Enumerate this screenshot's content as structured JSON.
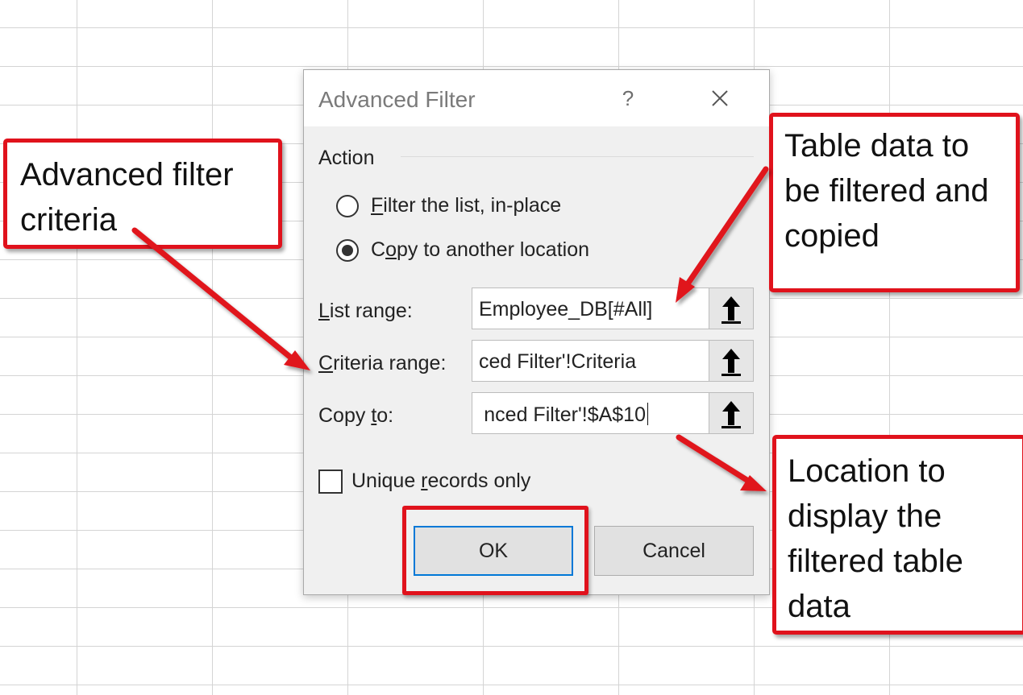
{
  "dialog": {
    "title": "Advanced Filter",
    "help_glyph": "?",
    "action_label": "Action",
    "radio_filter_inplace": {
      "mnemonic": "F",
      "rest": "ilter the list, in-place",
      "checked": false
    },
    "radio_copy_location": {
      "before": "C",
      "mnemonic": "o",
      "rest": "py to another location",
      "checked": true
    },
    "list_range": {
      "mnemonic": "L",
      "rest": "ist range:",
      "value": "Employee_DB[#All]"
    },
    "criteria_range": {
      "mnemonic": "C",
      "rest": "riteria range:",
      "value": "ced Filter'!Criteria"
    },
    "copy_to": {
      "before": "Copy ",
      "mnemonic": "t",
      "rest": "o:",
      "value": "nced Filter'!$A$10"
    },
    "unique_records": {
      "before": "Unique ",
      "mnemonic": "r",
      "rest": "ecords only",
      "checked": false
    },
    "ok_label": "OK",
    "cancel_label": "Cancel"
  },
  "annotations": {
    "criteria": [
      "Advanced filter",
      "criteria"
    ],
    "table_data": [
      "Table data to",
      "be filtered and",
      "copied"
    ],
    "location": [
      "Location to",
      "display the",
      "filtered table",
      "data"
    ]
  },
  "colors": {
    "annotation_red": "#e0121c",
    "ok_focus": "#0078d7",
    "dialog_bg": "#f0f0f0"
  },
  "icons": {
    "collapse": "up-arrow-icon",
    "close": "close-icon"
  }
}
